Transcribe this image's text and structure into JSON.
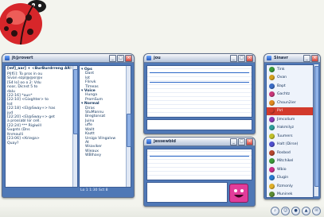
{
  "main_window": {
    "title": "jt@rovert",
    "header_text": "[mf]_aar] + <BurBurdrreng AR!",
    "chat_lines": [
      "Pl|f[i]: To pros in ou",
      "Sivan ezpl@@sr@v",
      "[S4 lo] oo o 2: Vdu",
      "noar, Dicnst 5 to",
      "dalu",
      "[22:16] *oun*",
      "[22:10] <Gixghter> to",
      "lsd",
      "[22:18] <El@Sway+> has",
      "jud",
      "[22:20] <El@Sway+> get",
      "a prossabl lor cell.",
      "[22:24] *** Rigiwill",
      "Gugnts (Dns",
      "ltnmoulli",
      "[23:06] <Kriega>",
      "Quay?"
    ],
    "status_left": "",
    "status_right": "Lo 1 1:30     Sct 8",
    "nick_groups": [
      {
        "label": "Ops",
        "items": [
          "Dant",
          "lot",
          "Flinvk",
          "Tlmeas"
        ]
      },
      {
        "label": "Voice",
        "items": [
          "Hunga",
          "PromSum"
        ]
      },
      {
        "label": "Normal",
        "items": [
          "Diras",
          "StuMannu",
          "Bregtonsat",
          "Juinu",
          "uffe",
          "Wallt",
          "Kaztt",
          "Ursiga Vilngalvw",
          "At",
          "Wsaviker",
          "Wieaux",
          "WBlhavy"
        ]
      }
    ]
  },
  "window_2": {
    "title": "jou",
    "lines": [
      "",
      "",
      ""
    ]
  },
  "window_3": {
    "title": "jessewbid",
    "lines": [
      "",
      "",
      ""
    ]
  },
  "buddy_window": {
    "title": "Sinavr",
    "buddies": [
      {
        "name": "Tink",
        "color": "#3c9b3a"
      },
      {
        "name": "Ovan",
        "color": "#d4a11e"
      },
      {
        "name": "Bapt",
        "color": "#3a6cc6"
      },
      {
        "name": "Gachtz",
        "color": "#c9367a"
      },
      {
        "name": "Choun2ier",
        "color": "#e08a21"
      },
      {
        "name": "Pirl",
        "color": "#d23a2c",
        "selected": true
      },
      {
        "name": "Jimcolium",
        "color": "#8d3ab6"
      },
      {
        "name": "Hakmilyz",
        "color": "#2f9e9a"
      },
      {
        "name": "Tuumers",
        "color": "#c0c02a"
      },
      {
        "name": "Halt (Dirse)",
        "color": "#4f4fcf"
      },
      {
        "name": "Rosbod",
        "color": "#b6462d"
      },
      {
        "name": "Mitchikel",
        "color": "#3c9b3a"
      },
      {
        "name": "Wbio",
        "color": "#cc2d8a"
      },
      {
        "name": "Elugin",
        "color": "#2a7ad0"
      },
      {
        "name": "Rzmonly",
        "color": "#e0b02a"
      },
      {
        "name": "Muninek",
        "color": "#5b8c32"
      },
      {
        "name": "Cosmrti",
        "color": "#6e44b5"
      },
      {
        "name": "Gilsenti",
        "color": "#c5402f"
      }
    ],
    "bottom_buttons": [
      "search",
      "user",
      "drop",
      "warn",
      "chat"
    ]
  },
  "colors": {
    "frame": "#4f78b6",
    "accent": "#2a67c8",
    "selected": "#d23a2c"
  }
}
